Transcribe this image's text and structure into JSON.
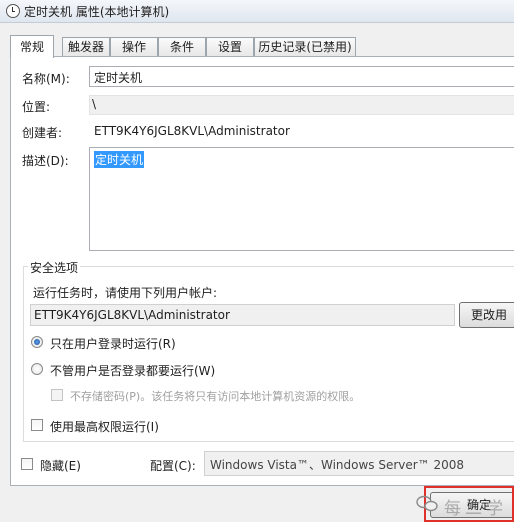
{
  "window": {
    "title": "定时关机 属性(本地计算机)"
  },
  "tabs": [
    {
      "label": "常规",
      "active": true
    },
    {
      "label": "触发器"
    },
    {
      "label": "操作"
    },
    {
      "label": "条件"
    },
    {
      "label": "设置"
    },
    {
      "label": "历史记录(已禁用)"
    }
  ],
  "general": {
    "name_label": "名称(M):",
    "name_value": "定时关机",
    "location_label": "位置:",
    "location_value": "\\",
    "author_label": "创建者:",
    "author_value": "ETT9K4Y6JGL8KVL\\Administrator",
    "description_label": "描述(D):",
    "description_value": "定时关机"
  },
  "security": {
    "group_title": "安全选项",
    "run_as_label": "运行任务时，请使用下列用户帐户:",
    "user_account": "ETT9K4Y6JGL8KVL\\Administrator",
    "change_user_button": "更改用",
    "radio_logged_on": "只在用户登录时运行(R)",
    "radio_logged_on_selected": true,
    "radio_whether_logged_on": "不管用户是否登录都要运行(W)",
    "no_store_password": "不存储密码(P)。该任务将只有访问本地计算机资源的权限。",
    "highest_privileges": "使用最高权限运行(I)"
  },
  "footer": {
    "hidden_label": "隐藏(E)",
    "configure_label": "配置(C):",
    "configure_value": "Windows Vista™、Windows Server™ 2008",
    "ok_button": "确定"
  },
  "watermark": {
    "text": "每二学"
  },
  "colors": {
    "selection": "#3399ff",
    "highlight_box": "#e0302a"
  }
}
